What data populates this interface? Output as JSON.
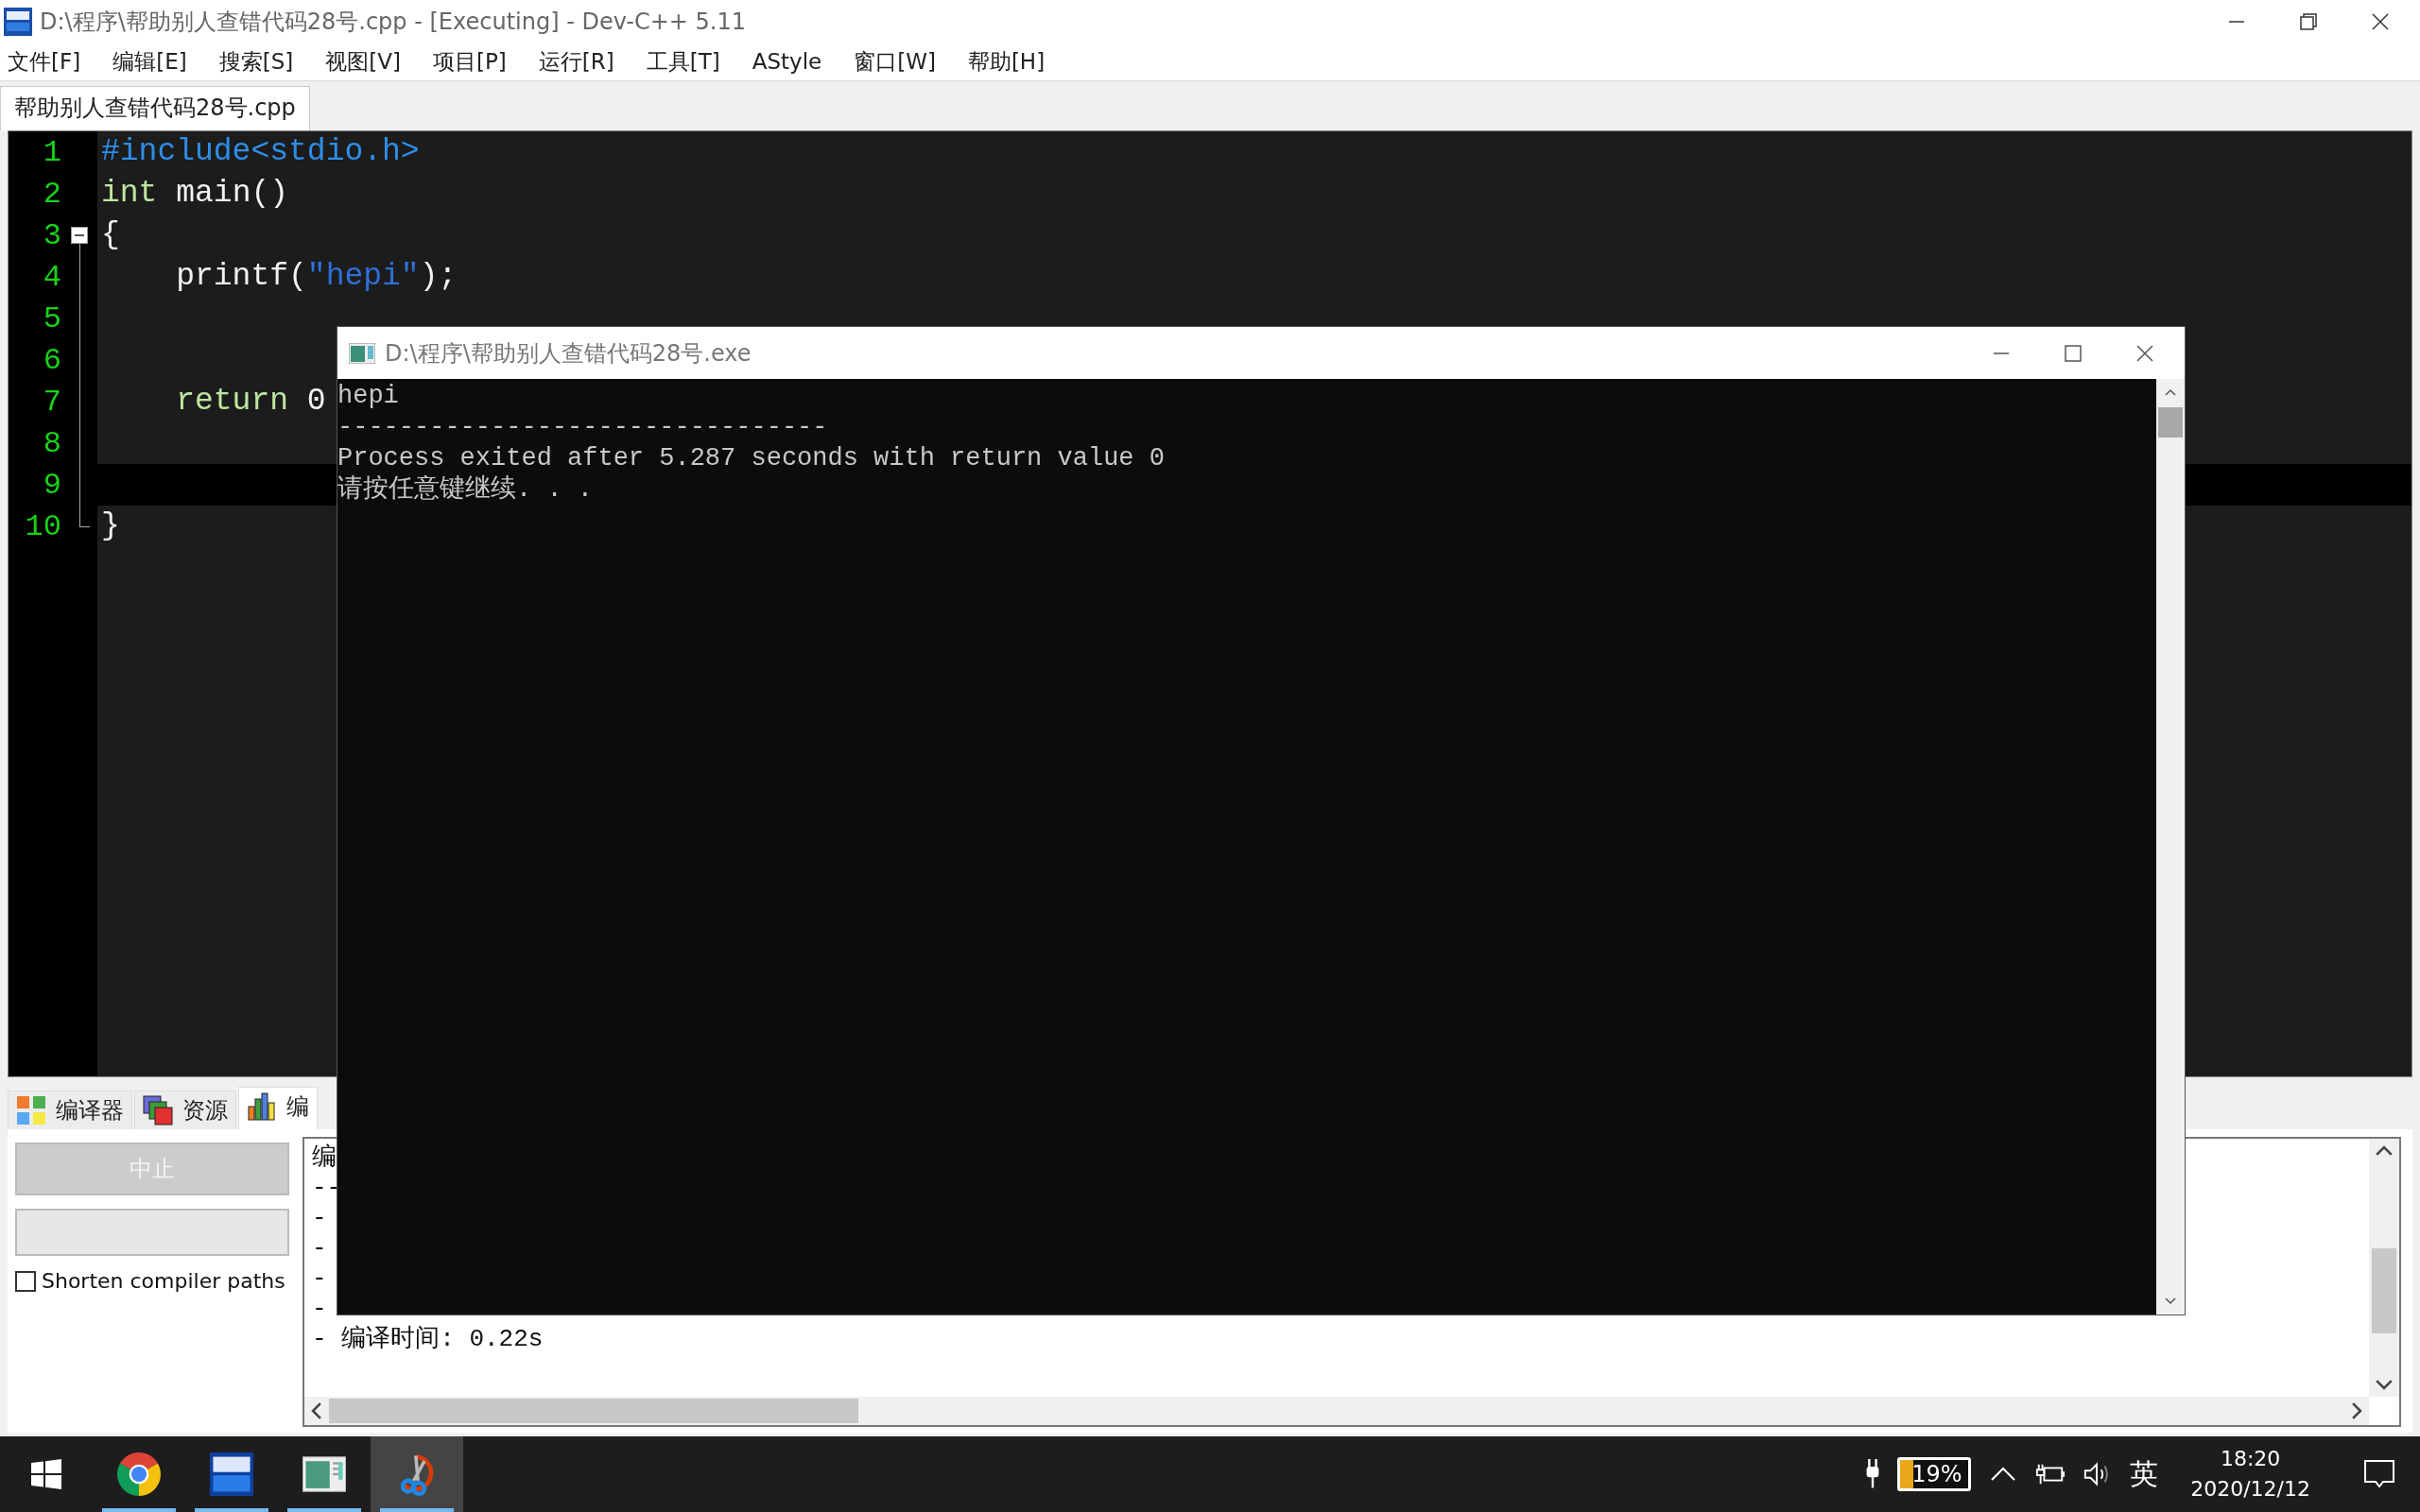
{
  "window": {
    "title": "D:\\程序\\帮助别人查错代码28号.cpp - [Executing] - Dev-C++ 5.11"
  },
  "menu": [
    "文件[F]",
    "编辑[E]",
    "搜索[S]",
    "视图[V]",
    "项目[P]",
    "运行[R]",
    "工具[T]",
    "AStyle",
    "窗口[W]",
    "帮助[H]"
  ],
  "file_tabs": [
    {
      "label": "帮助别人查错代码28号.cpp",
      "selected": true
    }
  ],
  "editor": {
    "lines": [
      {
        "number": "1",
        "tokens": [
          {
            "text": "#include<stdio.h>",
            "kind": "preprocessor"
          }
        ],
        "current": false
      },
      {
        "number": "2",
        "tokens": [
          {
            "text": "int",
            "kind": "keyword"
          },
          {
            "text": " main()",
            "kind": "plain"
          }
        ],
        "current": false
      },
      {
        "number": "3",
        "tokens": [
          {
            "text": "{",
            "kind": "plain"
          }
        ],
        "fold_toggle": {
          "expanded": true
        },
        "current": false
      },
      {
        "number": "4",
        "tokens": [
          {
            "text": "    printf(",
            "kind": "plain"
          },
          {
            "text": "\"hepi\"",
            "kind": "string"
          },
          {
            "text": ");",
            "kind": "plain"
          }
        ],
        "current": false
      },
      {
        "number": "5",
        "current": false
      },
      {
        "number": "6",
        "current": false
      },
      {
        "number": "7",
        "tokens": [
          {
            "text": "    return",
            "kind": "keyword"
          },
          {
            "text": " 0",
            "kind": "plain"
          }
        ],
        "current": false
      },
      {
        "number": "8",
        "current": false
      },
      {
        "number": "9",
        "current": true
      },
      {
        "number": "10",
        "tokens": [
          {
            "text": "}",
            "kind": "plain"
          }
        ],
        "current": false
      }
    ]
  },
  "bottom_panel": {
    "tabs": [
      {
        "label": "编译器",
        "selected": false
      },
      {
        "label": "资源",
        "selected": false
      },
      {
        "label": "编",
        "selected": true
      }
    ],
    "abort_button": {
      "label": "中止",
      "disabled": true
    },
    "checkbox": {
      "label": "Shorten compiler paths",
      "checked": false
    },
    "output_lines": [
      "编",
      "--",
      "-",
      "-",
      "-",
      "-",
      "- 编译时间: 0.22s"
    ]
  },
  "console": {
    "title": "D:\\程序\\帮助别人查错代码28号.exe",
    "lines": [
      "hepi",
      "--------------------------------",
      "Process exited after 5.287 seconds with return value 0",
      "请按任意键继续. . ."
    ]
  },
  "taskbar": {
    "apps": [
      {
        "kind": "start",
        "running": false,
        "selected": false
      },
      {
        "kind": "chrome",
        "running": true,
        "selected": false
      },
      {
        "kind": "devcpp",
        "running": true,
        "selected": false
      },
      {
        "kind": "console",
        "running": true,
        "selected": false
      },
      {
        "kind": "snip",
        "running": true,
        "selected": true
      }
    ],
    "battery": {
      "reading": "19%",
      "level": 0.19
    },
    "ime": "英",
    "time": "18:20",
    "date": "2020/12/12"
  }
}
